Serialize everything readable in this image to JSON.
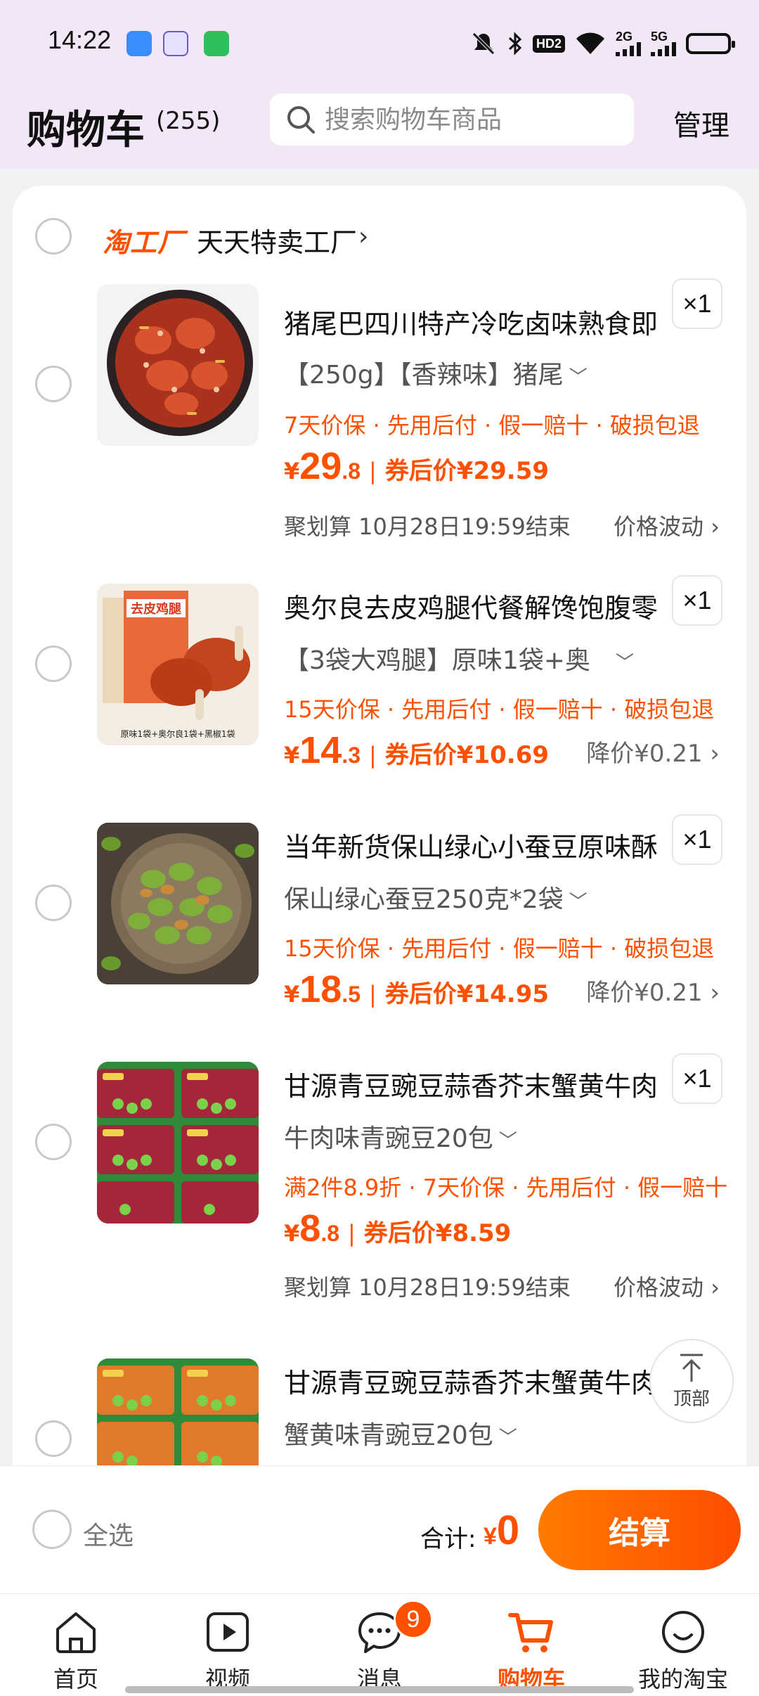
{
  "status_bar": {
    "time": "14:22",
    "hd_label": "HD2",
    "net1": "2G",
    "net2": "5G"
  },
  "header": {
    "title": "购物车",
    "count": "(255)",
    "search_placeholder": "搜索购物车商品",
    "manage": "管理"
  },
  "shop": {
    "logo": "淘工厂",
    "name": "天天特卖工厂",
    "chevron": "›"
  },
  "items": [
    {
      "title": "猪尾巴四川特产冷吃卤味熟食即",
      "qty": "×1",
      "variant": "【250g】【香辣味】猪尾",
      "services": "7天价保 · 先用后付 · 假一赔十 · 破损包退",
      "price_int": "29",
      "price_dec": ".8",
      "coupon": "券后价¥29.59",
      "promo": "聚划算 10月28日19:59结束",
      "trend": "价格波动 ›"
    },
    {
      "title": "奥尔良去皮鸡腿代餐解馋饱腹零",
      "qty": "×1",
      "variant": "【3袋大鸡腿】原味1袋+奥",
      "services": "15天价保 · 先用后付 · 假一赔十 · 破损包退",
      "price_int": "14",
      "price_dec": ".3",
      "coupon": "券后价¥10.69",
      "drop": "降价¥0.21 ›",
      "thumb_top_text": "去皮鸡腿",
      "thumb_caption": "原味1袋+奥尔良1袋+黑椒1袋"
    },
    {
      "title": "当年新货保山绿心小蚕豆原味酥",
      "qty": "×1",
      "variant": "保山绿心蚕豆250克*2袋",
      "services": "15天价保 · 先用后付 · 假一赔十 · 破损包退",
      "price_int": "18",
      "price_dec": ".5",
      "coupon": "券后价¥14.95",
      "drop": "降价¥0.21 ›"
    },
    {
      "title": "甘源青豆豌豆蒜香芥末蟹黄牛肉",
      "qty": "×1",
      "variant": "牛肉味青豌豆20包",
      "services": "满2件8.9折 · 7天价保 · 先用后付 · 假一赔十",
      "price_int": "8",
      "price_dec": ".8",
      "coupon": "券后价¥8.59",
      "promo": "聚划算 10月28日19:59结束",
      "trend": "价格波动 ›"
    },
    {
      "title": "甘源青豆豌豆蒜香芥末蟹黄牛肉",
      "variant": "蟹黄味青豌豆20包"
    }
  ],
  "currency": "¥",
  "separator": "|",
  "back_to_top": "顶部",
  "checkout": {
    "select_all": "全选",
    "total_label": "合计:",
    "total_currency": "¥",
    "total_value": "0",
    "button": "结算"
  },
  "tabs": [
    {
      "label": "首页",
      "icon": "home-icon"
    },
    {
      "label": "视频",
      "icon": "video-icon"
    },
    {
      "label": "消息",
      "icon": "message-icon",
      "badge": "9"
    },
    {
      "label": "购物车",
      "icon": "cart-icon",
      "active": true
    },
    {
      "label": "我的淘宝",
      "icon": "profile-icon"
    }
  ],
  "colors": {
    "accent": "#ff5000",
    "header_bg": "#f1e7f6",
    "page_bg": "#f2f2f4"
  }
}
